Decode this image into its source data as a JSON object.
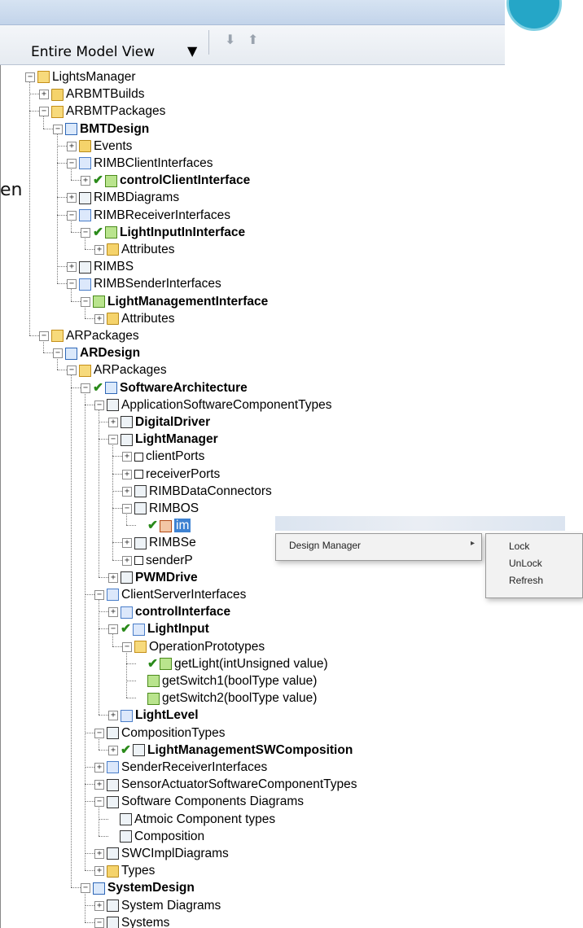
{
  "toolbar": {
    "view_select": "Entire Model View",
    "dropdown_arrow": "▼",
    "down_button": "⬇",
    "up_button": "⬆"
  },
  "slide_text": "en",
  "tree": [
    {
      "label": "LightsManager",
      "depth": 0,
      "exp": "-",
      "icon": "folder-open",
      "bold": false,
      "check": false
    },
    {
      "label": "ARBMTBuilds",
      "depth": 1,
      "exp": "+",
      "icon": "folder",
      "bold": false,
      "check": false
    },
    {
      "label": "ARBMTPackages",
      "depth": 1,
      "exp": "-",
      "icon": "folder-open",
      "bold": false,
      "check": false
    },
    {
      "label": "BMTDesign",
      "depth": 2,
      "exp": "-",
      "icon": "pkg",
      "bold": true,
      "check": false
    },
    {
      "label": "Events",
      "depth": 3,
      "exp": "+",
      "icon": "folder",
      "bold": false,
      "check": false
    },
    {
      "label": "RIMBClientInterfaces",
      "depth": 3,
      "exp": "-",
      "icon": "iface",
      "bold": false,
      "check": false
    },
    {
      "label": "controlClientInterface",
      "depth": 4,
      "exp": "+",
      "icon": "green",
      "bold": true,
      "check": true
    },
    {
      "label": "RIMBDiagrams",
      "depth": 3,
      "exp": "+",
      "icon": "comp",
      "bold": false,
      "check": false
    },
    {
      "label": "RIMBReceiverInterfaces",
      "depth": 3,
      "exp": "-",
      "icon": "iface",
      "bold": false,
      "check": false
    },
    {
      "label": "LightInputInInterface",
      "depth": 4,
      "exp": "-",
      "icon": "green",
      "bold": true,
      "check": true
    },
    {
      "label": "Attributes",
      "depth": 5,
      "exp": "+",
      "icon": "folder",
      "bold": false,
      "check": false
    },
    {
      "label": "RIMBS",
      "depth": 3,
      "exp": "+",
      "icon": "comp",
      "bold": false,
      "check": false
    },
    {
      "label": "RIMBSenderInterfaces",
      "depth": 3,
      "exp": "-",
      "icon": "iface",
      "bold": false,
      "check": false
    },
    {
      "label": "LightManagementInterface",
      "depth": 4,
      "exp": "-",
      "icon": "green",
      "bold": true,
      "check": false
    },
    {
      "label": "Attributes",
      "depth": 5,
      "exp": "+",
      "icon": "folder",
      "bold": false,
      "check": false
    },
    {
      "label": "ARPackages",
      "depth": 1,
      "exp": "-",
      "icon": "folder-open",
      "bold": false,
      "check": false
    },
    {
      "label": "ARDesign",
      "depth": 2,
      "exp": "-",
      "icon": "pkg",
      "bold": true,
      "check": false
    },
    {
      "label": "ARPackages",
      "depth": 3,
      "exp": "-",
      "icon": "folder-open",
      "bold": false,
      "check": false
    },
    {
      "label": "SoftwareArchitecture",
      "depth": 4,
      "exp": "-",
      "icon": "pkg",
      "bold": true,
      "check": true
    },
    {
      "label": "ApplicationSoftwareComponentTypes",
      "depth": 5,
      "exp": "-",
      "icon": "comp",
      "bold": false,
      "check": false
    },
    {
      "label": "DigitalDriver",
      "depth": 6,
      "exp": "+",
      "icon": "comp",
      "bold": true,
      "check": false
    },
    {
      "label": "LightManager",
      "depth": 6,
      "exp": "-",
      "icon": "comp",
      "bold": true,
      "check": false
    },
    {
      "label": "clientPorts",
      "depth": 7,
      "exp": "+",
      "icon": "port",
      "bold": false,
      "check": false
    },
    {
      "label": "receiverPorts",
      "depth": 7,
      "exp": "+",
      "icon": "port",
      "bold": false,
      "check": false
    },
    {
      "label": "RIMBDataConnectors",
      "depth": 7,
      "exp": "+",
      "icon": "comp",
      "bold": false,
      "check": false
    },
    {
      "label": "RIMBOS",
      "depth": 7,
      "exp": "-",
      "icon": "comp",
      "bold": false,
      "check": false
    },
    {
      "label": "im",
      "depth": 8,
      "exp": "",
      "icon": "red",
      "bold": false,
      "check": true,
      "selected": true
    },
    {
      "label": "RIMBSe",
      "depth": 7,
      "exp": "+",
      "icon": "comp",
      "bold": false,
      "check": false
    },
    {
      "label": "senderP",
      "depth": 7,
      "exp": "+",
      "icon": "port",
      "bold": false,
      "check": false
    },
    {
      "label": "PWMDrive",
      "depth": 6,
      "exp": "+",
      "icon": "comp",
      "bold": true,
      "check": false
    },
    {
      "label": "ClientServerInterfaces",
      "depth": 5,
      "exp": "-",
      "icon": "iface",
      "bold": false,
      "check": false
    },
    {
      "label": "controlInterface",
      "depth": 6,
      "exp": "+",
      "icon": "iface",
      "bold": true,
      "check": false
    },
    {
      "label": "LightInput",
      "depth": 6,
      "exp": "-",
      "icon": "iface",
      "bold": true,
      "check": true
    },
    {
      "label": "OperationPrototypes",
      "depth": 7,
      "exp": "-",
      "icon": "folder-open",
      "bold": false,
      "check": false
    },
    {
      "label": "getLight(intUnsigned value)",
      "depth": 8,
      "exp": "",
      "icon": "green",
      "bold": false,
      "check": true
    },
    {
      "label": "getSwitch1(boolType value)",
      "depth": 8,
      "exp": "",
      "icon": "green",
      "bold": false,
      "check": false
    },
    {
      "label": "getSwitch2(boolType value)",
      "depth": 8,
      "exp": "",
      "icon": "green",
      "bold": false,
      "check": false
    },
    {
      "label": "LightLevel",
      "depth": 6,
      "exp": "+",
      "icon": "iface",
      "bold": true,
      "check": false
    },
    {
      "label": "CompositionTypes",
      "depth": 5,
      "exp": "-",
      "icon": "comp",
      "bold": false,
      "check": false
    },
    {
      "label": "LightManagementSWComposition",
      "depth": 6,
      "exp": "+",
      "icon": "comp",
      "bold": true,
      "check": true
    },
    {
      "label": "SenderReceiverInterfaces",
      "depth": 5,
      "exp": "+",
      "icon": "iface",
      "bold": false,
      "check": false
    },
    {
      "label": "SensorActuatorSoftwareComponentTypes",
      "depth": 5,
      "exp": "+",
      "icon": "comp",
      "bold": false,
      "check": false
    },
    {
      "label": "Software Components Diagrams",
      "depth": 5,
      "exp": "-",
      "icon": "comp",
      "bold": false,
      "check": false
    },
    {
      "label": "Atmoic Component types",
      "depth": 6,
      "exp": "",
      "icon": "comp",
      "bold": false,
      "check": false
    },
    {
      "label": "Composition",
      "depth": 6,
      "exp": "",
      "icon": "comp",
      "bold": false,
      "check": false
    },
    {
      "label": "SWCImplDiagrams",
      "depth": 5,
      "exp": "+",
      "icon": "comp",
      "bold": false,
      "check": false
    },
    {
      "label": "Types",
      "depth": 5,
      "exp": "+",
      "icon": "folder",
      "bold": false,
      "check": false
    },
    {
      "label": "SystemDesign",
      "depth": 4,
      "exp": "-",
      "icon": "pkg",
      "bold": true,
      "check": false
    },
    {
      "label": "System Diagrams",
      "depth": 5,
      "exp": "+",
      "icon": "comp",
      "bold": false,
      "check": false
    },
    {
      "label": "Systems",
      "depth": 5,
      "exp": "-",
      "icon": "comp",
      "bold": false,
      "check": false
    }
  ],
  "context_menu": {
    "item": "Design Manager",
    "arrow": "▸",
    "submenu": [
      "Lock",
      "UnLock",
      "Refresh"
    ]
  }
}
